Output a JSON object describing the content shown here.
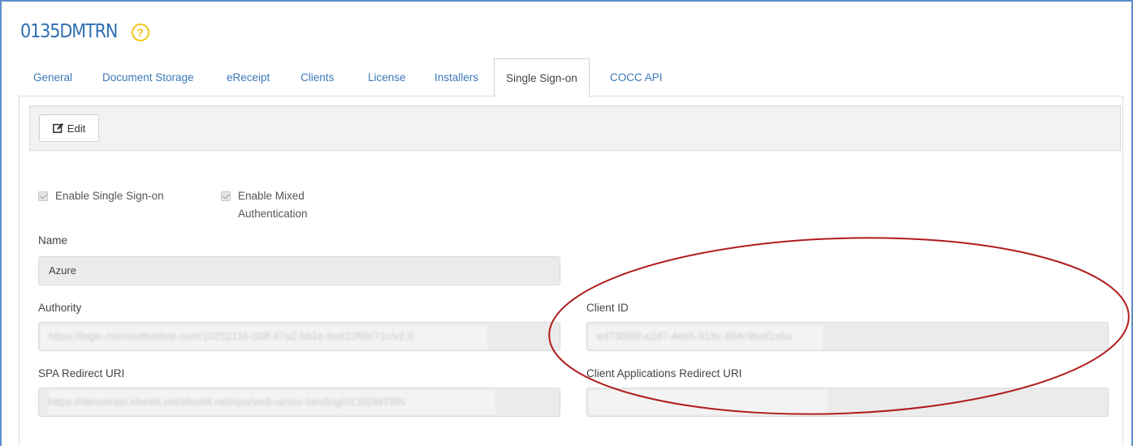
{
  "header": {
    "title": "0135DMTRN",
    "help_icon": "question-circle-icon"
  },
  "tabs": [
    {
      "label": "General"
    },
    {
      "label": "Document Storage"
    },
    {
      "label": "eReceipt"
    },
    {
      "label": "Clients"
    },
    {
      "label": "License"
    },
    {
      "label": "Installers"
    },
    {
      "label": "Single Sign-on",
      "active": true
    },
    {
      "label": "COCC API"
    }
  ],
  "toolbar": {
    "edit_label": "Edit",
    "edit_icon": "edit-icon"
  },
  "form": {
    "enable_sso_label": "Enable Single Sign-on",
    "enable_mixed_auth_label_line1": "Enable Mixed",
    "enable_mixed_auth_label_line2": "Authentication",
    "name_label": "Name",
    "name_value": "Azure",
    "authority_label": "Authority",
    "authority_value": "https://login.microsoftonline.com/10252116-03ff-47a2-bb1e-6e812f9fc71c/v2.0",
    "client_id_label": "Client ID",
    "client_id_value": "e473095f-e2d7-4ea5-918c-894c9baf1e5a",
    "spa_redirect_label": "SPA Redirect URI",
    "spa_redirect_value": "https://demotrain.identifi.net/identifi.net/spa/web-ui/sso-landing/0135DMTRN",
    "client_apps_redirect_label": "Client Applications Redirect URI",
    "client_apps_redirect_value": ""
  },
  "colors": {
    "accent": "#2e6fb3",
    "help": "#f2c314",
    "annotation": "#b01c1c"
  }
}
